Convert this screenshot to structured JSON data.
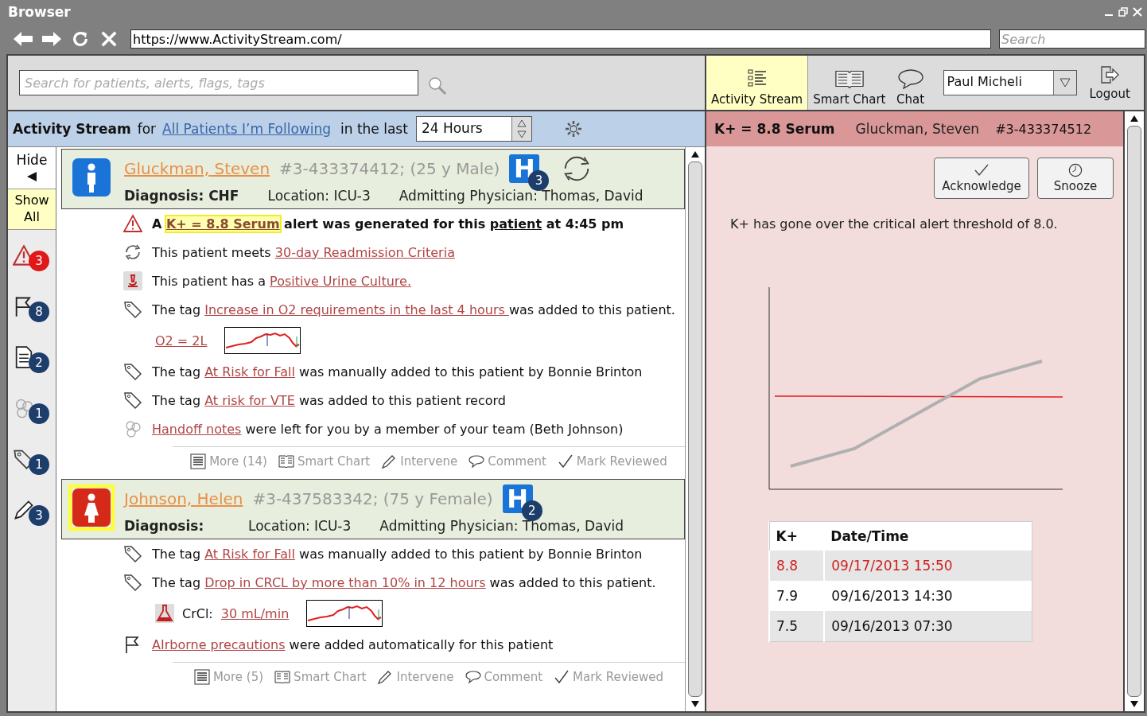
{
  "browser": {
    "title": "Browser",
    "url": "https://www.ActivityStream.com/",
    "search_placeholder": "Search"
  },
  "app_search": {
    "placeholder": "Search for patients, alerts, flags, tags"
  },
  "nav": [
    {
      "kind": "stream",
      "label": "Activity Stream",
      "selected": true
    },
    {
      "kind": "chart",
      "label": "Smart Chart",
      "selected": false
    },
    {
      "kind": "chat",
      "label": "Chat",
      "selected": false
    }
  ],
  "user": "Paul Micheli",
  "logout": "Logout",
  "stream_header": {
    "title": "Activity Stream",
    "for": "for",
    "filter_link": "All Patients I’m Following",
    "in_the_last": "in the last",
    "period": "24 Hours"
  },
  "sidebar": {
    "hide": "Hide",
    "show_all": {
      "label": "Show All",
      "selected": true
    },
    "counters": [
      {
        "kind": "alert",
        "count": "3",
        "color": "#e01818"
      },
      {
        "kind": "flag",
        "count": "8",
        "color": "#1d3d6b"
      },
      {
        "kind": "document",
        "count": "2",
        "color": "#1d3d6b"
      },
      {
        "kind": "team",
        "count": "1",
        "color": "#1d3d6b"
      },
      {
        "kind": "tag",
        "count": "1",
        "color": "#1d3d6b"
      },
      {
        "kind": "pencil",
        "count": "3",
        "color": "#1d3d6b"
      }
    ]
  },
  "patients": [
    {
      "kind": "male",
      "avatar_highlighted": false,
      "name": "Gluckman, Steven",
      "details": "#3-433374412; (25 y Male)",
      "admission": {
        "letter": "H",
        "count": "3"
      },
      "readmission": true,
      "diagnosis": "Diagnosis: CHF",
      "location": "Location:  ICU-3",
      "physician": "Admitting Physician:  Thomas, David",
      "events": [
        {
          "kind": "alert",
          "bold": true,
          "segments": [
            {
              "t": "A "
            },
            {
              "t": "K+ = 8.8 Serum",
              "kind": "link",
              "highlight": true
            },
            {
              "t": " alert was generated for this "
            },
            {
              "t": "patient",
              "kind": "term"
            },
            {
              "t": " at 4:45 pm"
            }
          ]
        },
        {
          "kind": "readmission",
          "segments": [
            {
              "t": "This patient meets "
            },
            {
              "t": "30-day Readmission Criteria",
              "kind": "link"
            }
          ]
        },
        {
          "kind": "lab",
          "segments": [
            {
              "t": "This patient has a "
            },
            {
              "t": "Positive Urine Culture.",
              "kind": "link"
            }
          ]
        },
        {
          "kind": "tag",
          "segments": [
            {
              "t": "The tag "
            },
            {
              "t": "Increase in O2 requirements in the last 4 hours ",
              "kind": "link"
            },
            {
              "t": "was added to this patient."
            }
          ]
        },
        {
          "kind": "measure",
          "value": "O2 = 2L"
        },
        {
          "kind": "tag",
          "segments": [
            {
              "t": "The tag "
            },
            {
              "t": "At Risk for Fall",
              "kind": "link"
            },
            {
              "t": " was manually added to this patient by Bonnie Brinton"
            }
          ]
        },
        {
          "kind": "tag",
          "segments": [
            {
              "t": "The tag "
            },
            {
              "t": "At risk for VTE",
              "kind": "link"
            },
            {
              "t": " was added to this patient record"
            }
          ]
        },
        {
          "kind": "team",
          "segments": [
            {
              "t": "Handoff notes",
              "kind": "link"
            },
            {
              "t": " were left for you by a member of your team (Beth Johnson)"
            }
          ]
        }
      ],
      "actions": [
        {
          "kind": "more",
          "label": "More (14)"
        },
        {
          "kind": "chart",
          "label": "Smart Chart"
        },
        {
          "kind": "intervene",
          "label": "Intervene"
        },
        {
          "kind": "comment",
          "label": "Comment"
        },
        {
          "kind": "review",
          "label": "Mark Reviewed"
        }
      ]
    },
    {
      "kind": "female",
      "avatar_highlighted": true,
      "name": "Johnson, Helen",
      "details": "#3-437583342; (75 y Female)",
      "admission": {
        "letter": "H",
        "count": "2"
      },
      "readmission": false,
      "diagnosis": "Diagnosis:",
      "location": "Location:  ICU-3",
      "physician": "Admitting Physician:  Thomas, David",
      "events": [
        {
          "kind": "tag",
          "segments": [
            {
              "t": "The tag "
            },
            {
              "t": "At Risk for Fall",
              "kind": "link"
            },
            {
              "t": " was manually added to this patient by Bonnie Brinton"
            }
          ]
        },
        {
          "kind": "tag",
          "segments": [
            {
              "t": "The tag "
            },
            {
              "t": "Drop in CRCL by more than 10% in 12 hours",
              "kind": "link"
            },
            {
              "t": " was added to this patient."
            }
          ]
        },
        {
          "kind": "lab_measure",
          "label": "CrCl:",
          "value": "30 mL/min"
        },
        {
          "kind": "flag",
          "segments": [
            {
              "t": "AIrborne precautions",
              "kind": "link"
            },
            {
              "t": " were added automatically for this patient"
            }
          ]
        }
      ],
      "actions": [
        {
          "kind": "more",
          "label": "More (5)"
        },
        {
          "kind": "chart",
          "label": "Smart Chart"
        },
        {
          "kind": "intervene",
          "label": "Intervene"
        },
        {
          "kind": "comment",
          "label": "Comment"
        },
        {
          "kind": "review",
          "label": "Mark Reviewed"
        }
      ]
    }
  ],
  "alert_panel": {
    "title": "K+ = 8.8 Serum",
    "patient": "Gluckman, Steven",
    "id": "#3-433374512",
    "buttons": [
      {
        "kind": "acknowledge",
        "label": "Acknowledge"
      },
      {
        "kind": "snooze",
        "label": "Snooze"
      }
    ],
    "message": "K+ has gone over the critical alert threshold of 8.0.",
    "table": {
      "columns": [
        "K+",
        "Date/Time"
      ],
      "rows": [
        {
          "cells": [
            "8.8",
            "09/17/2013  15:50"
          ],
          "critical": true
        },
        {
          "cells": [
            "7.9",
            "09/16/2013  14:30"
          ],
          "critical": false
        },
        {
          "cells": [
            "7.5",
            "09/16/2013  07:30"
          ],
          "critical": false
        }
      ]
    }
  }
}
